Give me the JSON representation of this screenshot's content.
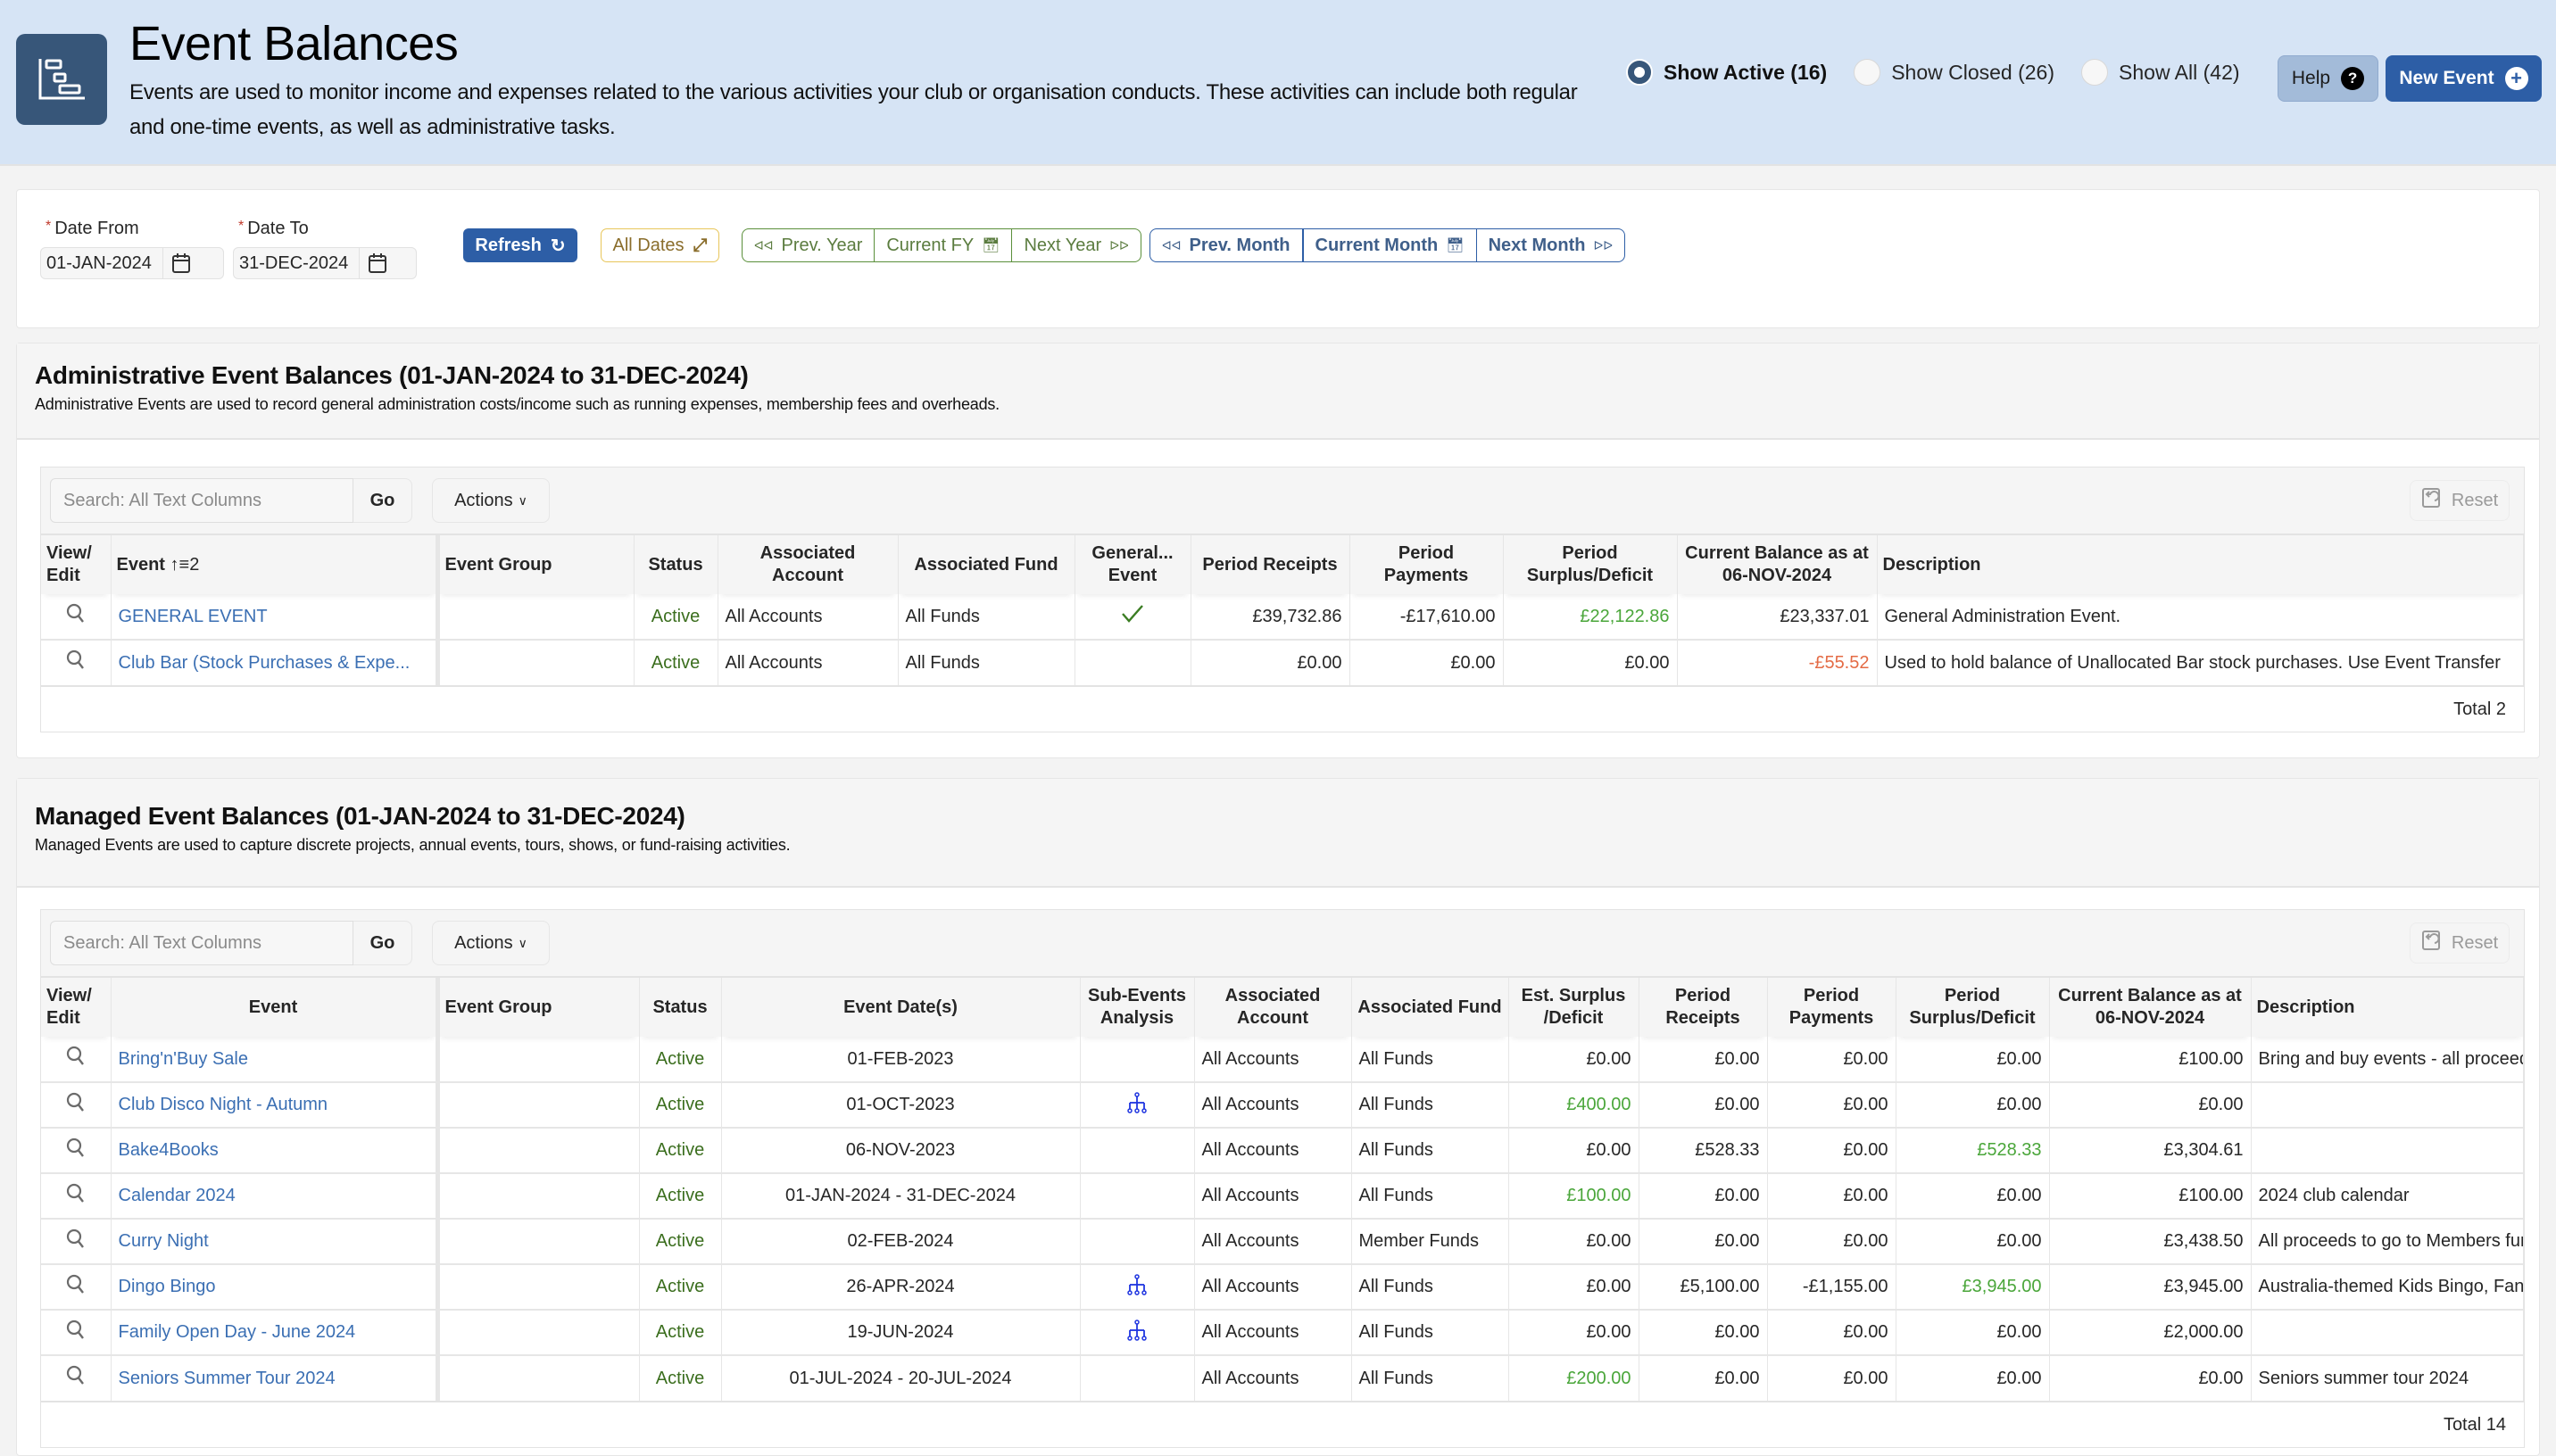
{
  "header": {
    "title": "Event Balances",
    "description": "Events are used to monitor income and expenses related to the various activities your club or organisation conducts. These activities can include both regular and one-time events, as well as administrative tasks.",
    "icon": "gantt-chart-icon",
    "filters": [
      {
        "label": "Show Active (16)",
        "checked": true
      },
      {
        "label": "Show Closed (26)",
        "checked": false
      },
      {
        "label": "Show All (42)",
        "checked": false
      }
    ],
    "help_label": "Help",
    "new_event_label": "New Event"
  },
  "dates": {
    "date_from_label": "Date From",
    "date_from_value": "01-JAN-2024",
    "date_to_label": "Date To",
    "date_to_value": "31-DEC-2024",
    "refresh_label": "Refresh",
    "all_dates_label": "All Dates",
    "prev_year_label": "Prev. Year",
    "current_fy_label": "Current FY",
    "next_year_label": "Next Year",
    "prev_month_label": "Prev. Month",
    "current_month_label": "Current Month",
    "next_month_label": "Next Month"
  },
  "admin": {
    "title": "Administrative Event Balances (01-JAN-2024 to 31-DEC-2024)",
    "subtitle": "Administrative Events are used to record general administration costs/income such as running expenses, membership fees and overheads.",
    "search_placeholder": "Search: All Text Columns",
    "go_label": "Go",
    "actions_label": "Actions",
    "reset_label": "Reset",
    "columns": [
      "View/ Edit",
      "Event",
      "Event Group",
      "Status",
      "Associated Account",
      "Associated Fund",
      "General... Event",
      "Period Receipts",
      "Period Payments",
      "Period Surplus/Deficit",
      "Current Balance as at 06-NOV-2024",
      "Description"
    ],
    "event_sort_indicator": "2",
    "rows": [
      {
        "event": "GENERAL EVENT",
        "group": "",
        "status": "Active",
        "account": "All Accounts",
        "fund": "All Funds",
        "general": true,
        "receipts": "£39,732.86",
        "payments": "-£17,610.00",
        "surplus": "£22,122.86",
        "balance": "£23,337.01",
        "description": "General Administration Event."
      },
      {
        "event": "Club Bar (Stock Purchases & Expe...",
        "group": "",
        "status": "Active",
        "account": "All Accounts",
        "fund": "All Funds",
        "general": false,
        "receipts": "£0.00",
        "payments": "£0.00",
        "surplus": "£0.00",
        "balance": "-£55.52",
        "description": "Used to hold balance of Unallocated Bar stock purchases. Use Event Transfer"
      }
    ],
    "total": "Total 2"
  },
  "managed": {
    "title": "Managed Event Balances (01-JAN-2024 to 31-DEC-2024)",
    "subtitle": "Managed Events are used to capture discrete projects, annual events, tours, shows, or fund-raising activities.",
    "search_placeholder": "Search: All Text Columns",
    "go_label": "Go",
    "actions_label": "Actions",
    "reset_label": "Reset",
    "columns": [
      "View/ Edit",
      "Event",
      "Event Group",
      "Status",
      "Event Date(s)",
      "Sub-Events Analysis",
      "Associated Account",
      "Associated Fund",
      "Est. Surplus /Deficit",
      "Period Receipts",
      "Period Payments",
      "Period Surplus/Deficit",
      "Current Balance as at 06-NOV-2024",
      "Description"
    ],
    "rows": [
      {
        "event": "Bring'n'Buy Sale",
        "group": "",
        "status": "Active",
        "dates": "01-FEB-2023",
        "sub": false,
        "account": "All Accounts",
        "fund": "All Funds",
        "est": "£0.00",
        "receipts": "£0.00",
        "payments": "£0.00",
        "surplus": "£0.00",
        "balance": "£100.00",
        "description": "Bring and buy events - all proceeds to Cla"
      },
      {
        "event": "Club Disco Night - Autumn",
        "group": "",
        "status": "Active",
        "dates": "01-OCT-2023",
        "sub": true,
        "account": "All Accounts",
        "fund": "All Funds",
        "est": "£400.00",
        "receipts": "£0.00",
        "payments": "£0.00",
        "surplus": "£0.00",
        "balance": "£0.00",
        "description": ""
      },
      {
        "event": "Bake4Books",
        "group": "",
        "status": "Active",
        "dates": "06-NOV-2023",
        "sub": false,
        "account": "All Accounts",
        "fund": "All Funds",
        "est": "£0.00",
        "receipts": "£528.33",
        "payments": "£0.00",
        "surplus": "£528.33",
        "balance": "£3,304.61",
        "description": ""
      },
      {
        "event": "Calendar 2024",
        "group": "",
        "status": "Active",
        "dates": "01-JAN-2024 - 31-DEC-2024",
        "sub": false,
        "account": "All Accounts",
        "fund": "All Funds",
        "est": "£100.00",
        "receipts": "£0.00",
        "payments": "£0.00",
        "surplus": "£0.00",
        "balance": "£100.00",
        "description": "2024 club calendar"
      },
      {
        "event": "Curry Night",
        "group": "",
        "status": "Active",
        "dates": "02-FEB-2024",
        "sub": false,
        "account": "All Accounts",
        "fund": "Member Funds",
        "est": "£0.00",
        "receipts": "£0.00",
        "payments": "£0.00",
        "surplus": "£0.00",
        "balance": "£3,438.50",
        "description": "All proceeds to go to Members fund."
      },
      {
        "event": "Dingo Bingo",
        "group": "",
        "status": "Active",
        "dates": "26-APR-2024",
        "sub": true,
        "account": "All Accounts",
        "fund": "All Funds",
        "est": "£0.00",
        "receipts": "£5,100.00",
        "payments": "-£1,155.00",
        "surplus": "£3,945.00",
        "balance": "£3,945.00",
        "description": "Australia-themed Kids Bingo, Fancy Dress"
      },
      {
        "event": "Family Open Day - June 2024",
        "group": "",
        "status": "Active",
        "dates": "19-JUN-2024",
        "sub": true,
        "account": "All Accounts",
        "fund": "All Funds",
        "est": "£0.00",
        "receipts": "£0.00",
        "payments": "£0.00",
        "surplus": "£0.00",
        "balance": "£2,000.00",
        "description": ""
      },
      {
        "event": "Seniors Summer Tour 2024",
        "group": "",
        "status": "Active",
        "dates": "01-JUL-2024 - 20-JUL-2024",
        "sub": false,
        "account": "All Accounts",
        "fund": "All Funds",
        "est": "£200.00",
        "receipts": "£0.00",
        "payments": "£0.00",
        "surplus": "£0.00",
        "balance": "£0.00",
        "description": "Seniors summer tour 2024"
      }
    ],
    "total": "Total 14"
  },
  "colors": {
    "brand": "#2d5ea6",
    "header_bg": "#d6e4f5",
    "positive": "#4aa63a",
    "negative": "#e46b45",
    "status_active": "#3b6e1e",
    "link": "#3b6fb3"
  }
}
